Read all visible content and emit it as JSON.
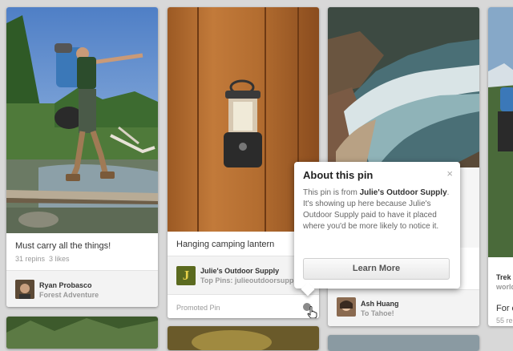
{
  "pins": [
    {
      "title": "Must carry all the things!",
      "stats": "31 repins  3 likes",
      "user": "Ryan Probasco",
      "board": "Forest Adventure"
    },
    {
      "title": "Hanging camping lantern",
      "user": "Julie's Outdoor Supply",
      "board": "Top Pins: julieoutdoorsupply",
      "logo_letter": "J",
      "promoted_label": "Promoted Pin"
    },
    {
      "user": "Ash Huang",
      "board": "To Tahoe!"
    },
    {
      "user_partial": "Trek",
      "board_partial": "world",
      "title_partial": "For e",
      "stats_partial": "55 re"
    }
  ],
  "popover": {
    "title": "About this pin",
    "close_glyph": "×",
    "text_intro": "This pin is from ",
    "text_brand": "Julie's Outdoor Supply",
    "text_rest": ". It's showing up here because Julie's Outdoor Supply paid to have it placed where you'd be more likely to notice it.",
    "button_label": "Learn More"
  },
  "colors": {
    "background": "#d8d8d8",
    "card": "#ffffff",
    "attribution_bg": "#f3f3f3",
    "muted_text": "#999999"
  }
}
